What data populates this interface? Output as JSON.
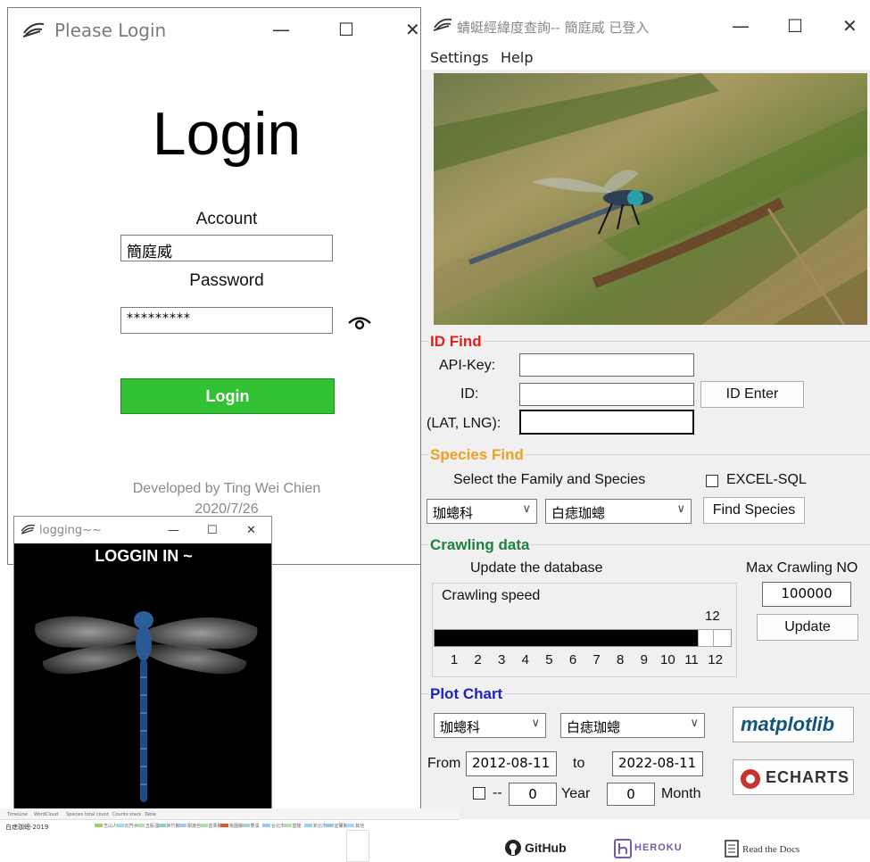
{
  "login_window": {
    "title": "Please Login",
    "heading": "Login",
    "account_label": "Account",
    "account_value": "簡庭威",
    "password_label": "Password",
    "password_value": "*********",
    "login_button": "Login",
    "developer_line": "Developed by Ting Wei Chien",
    "date_line": "2020/7/26",
    "controls": {
      "minimize": "—",
      "maximize": "☐",
      "close": "✕"
    }
  },
  "logging_window": {
    "title": "logging~~",
    "message": "LOGGIN IN ~",
    "controls": {
      "minimize": "—",
      "maximize": "☐",
      "close": "✕"
    }
  },
  "main_window": {
    "title": "蜻蜓經緯度查詢-- 簡庭威 已登入",
    "controls": {
      "minimize": "—",
      "maximize": "☐",
      "close": "✕"
    },
    "menu": [
      "Settings",
      "Help"
    ],
    "id_find": {
      "title": "ID Find",
      "title_color": "#e02020",
      "api_key_label": "API-Key:",
      "id_label": "ID:",
      "latlng_label": "(LAT, LNG):",
      "id_enter_button": "ID Enter"
    },
    "species_find": {
      "title": "Species Find",
      "title_color": "#f0a020",
      "select_label": "Select the Family and Species",
      "excel_sql_label": "EXCEL-SQL",
      "family_value": "珈蟌科",
      "species_value": "白痣珈蟌",
      "find_button": "Find Species"
    },
    "crawling": {
      "title": "Crawling data",
      "title_color": "#208040",
      "update_label": "Update the database",
      "max_label": "Max Crawling NO",
      "max_value": "100000",
      "update_button": "Update",
      "speed_label": "Crawling speed",
      "slider_value": "12",
      "slider_fraction": 0.92,
      "ticks": [
        "1",
        "2",
        "3",
        "4",
        "5",
        "6",
        "7",
        "8",
        "9",
        "10",
        "11",
        "12"
      ]
    },
    "plot_chart": {
      "title": "Plot Chart",
      "title_color": "#2020c0",
      "family_value": "珈蟌科",
      "species_value": "白痣珈蟌",
      "from_label": "From",
      "from_value": "2012-08-11",
      "to_label": "to",
      "to_value": "2022-08-11",
      "dash_label": "--",
      "year_value": "0",
      "year_label": "Year",
      "month_value": "0",
      "month_label": "Month",
      "matplotlib_logo": "matplotlib",
      "echarts_logo": "ECHARTS"
    }
  },
  "bottom_strip": {
    "tabs": [
      "TimeLine",
      "WordCloud",
      "Species total count",
      "Counts stack",
      "Table"
    ],
    "chart_title": "白痣珈蟌-2019",
    "legend": [
      "芝山人",
      "石門水",
      "五股溼",
      "新竹縣",
      "關渡自",
      "苗栗縣",
      "桃園縣",
      "雙溪",
      "台北市",
      "基隆",
      "新北市",
      "宜蘭縣",
      "其他"
    ],
    "legend_colors": [
      "#9ad066",
      "#a8d8f0",
      "#b0e0a0",
      "#90d0c0",
      "#a0c8f0",
      "#a8e0a8",
      "#e85020",
      "#a0d8c0",
      "#9cc8f0",
      "#b0e0b0",
      "#a0d0f0",
      "#90c8e8",
      "#a8d8f8"
    ]
  },
  "footer_logos": {
    "github": "GitHub",
    "heroku": "HEROKU",
    "readthedocs": "Read the Docs"
  }
}
